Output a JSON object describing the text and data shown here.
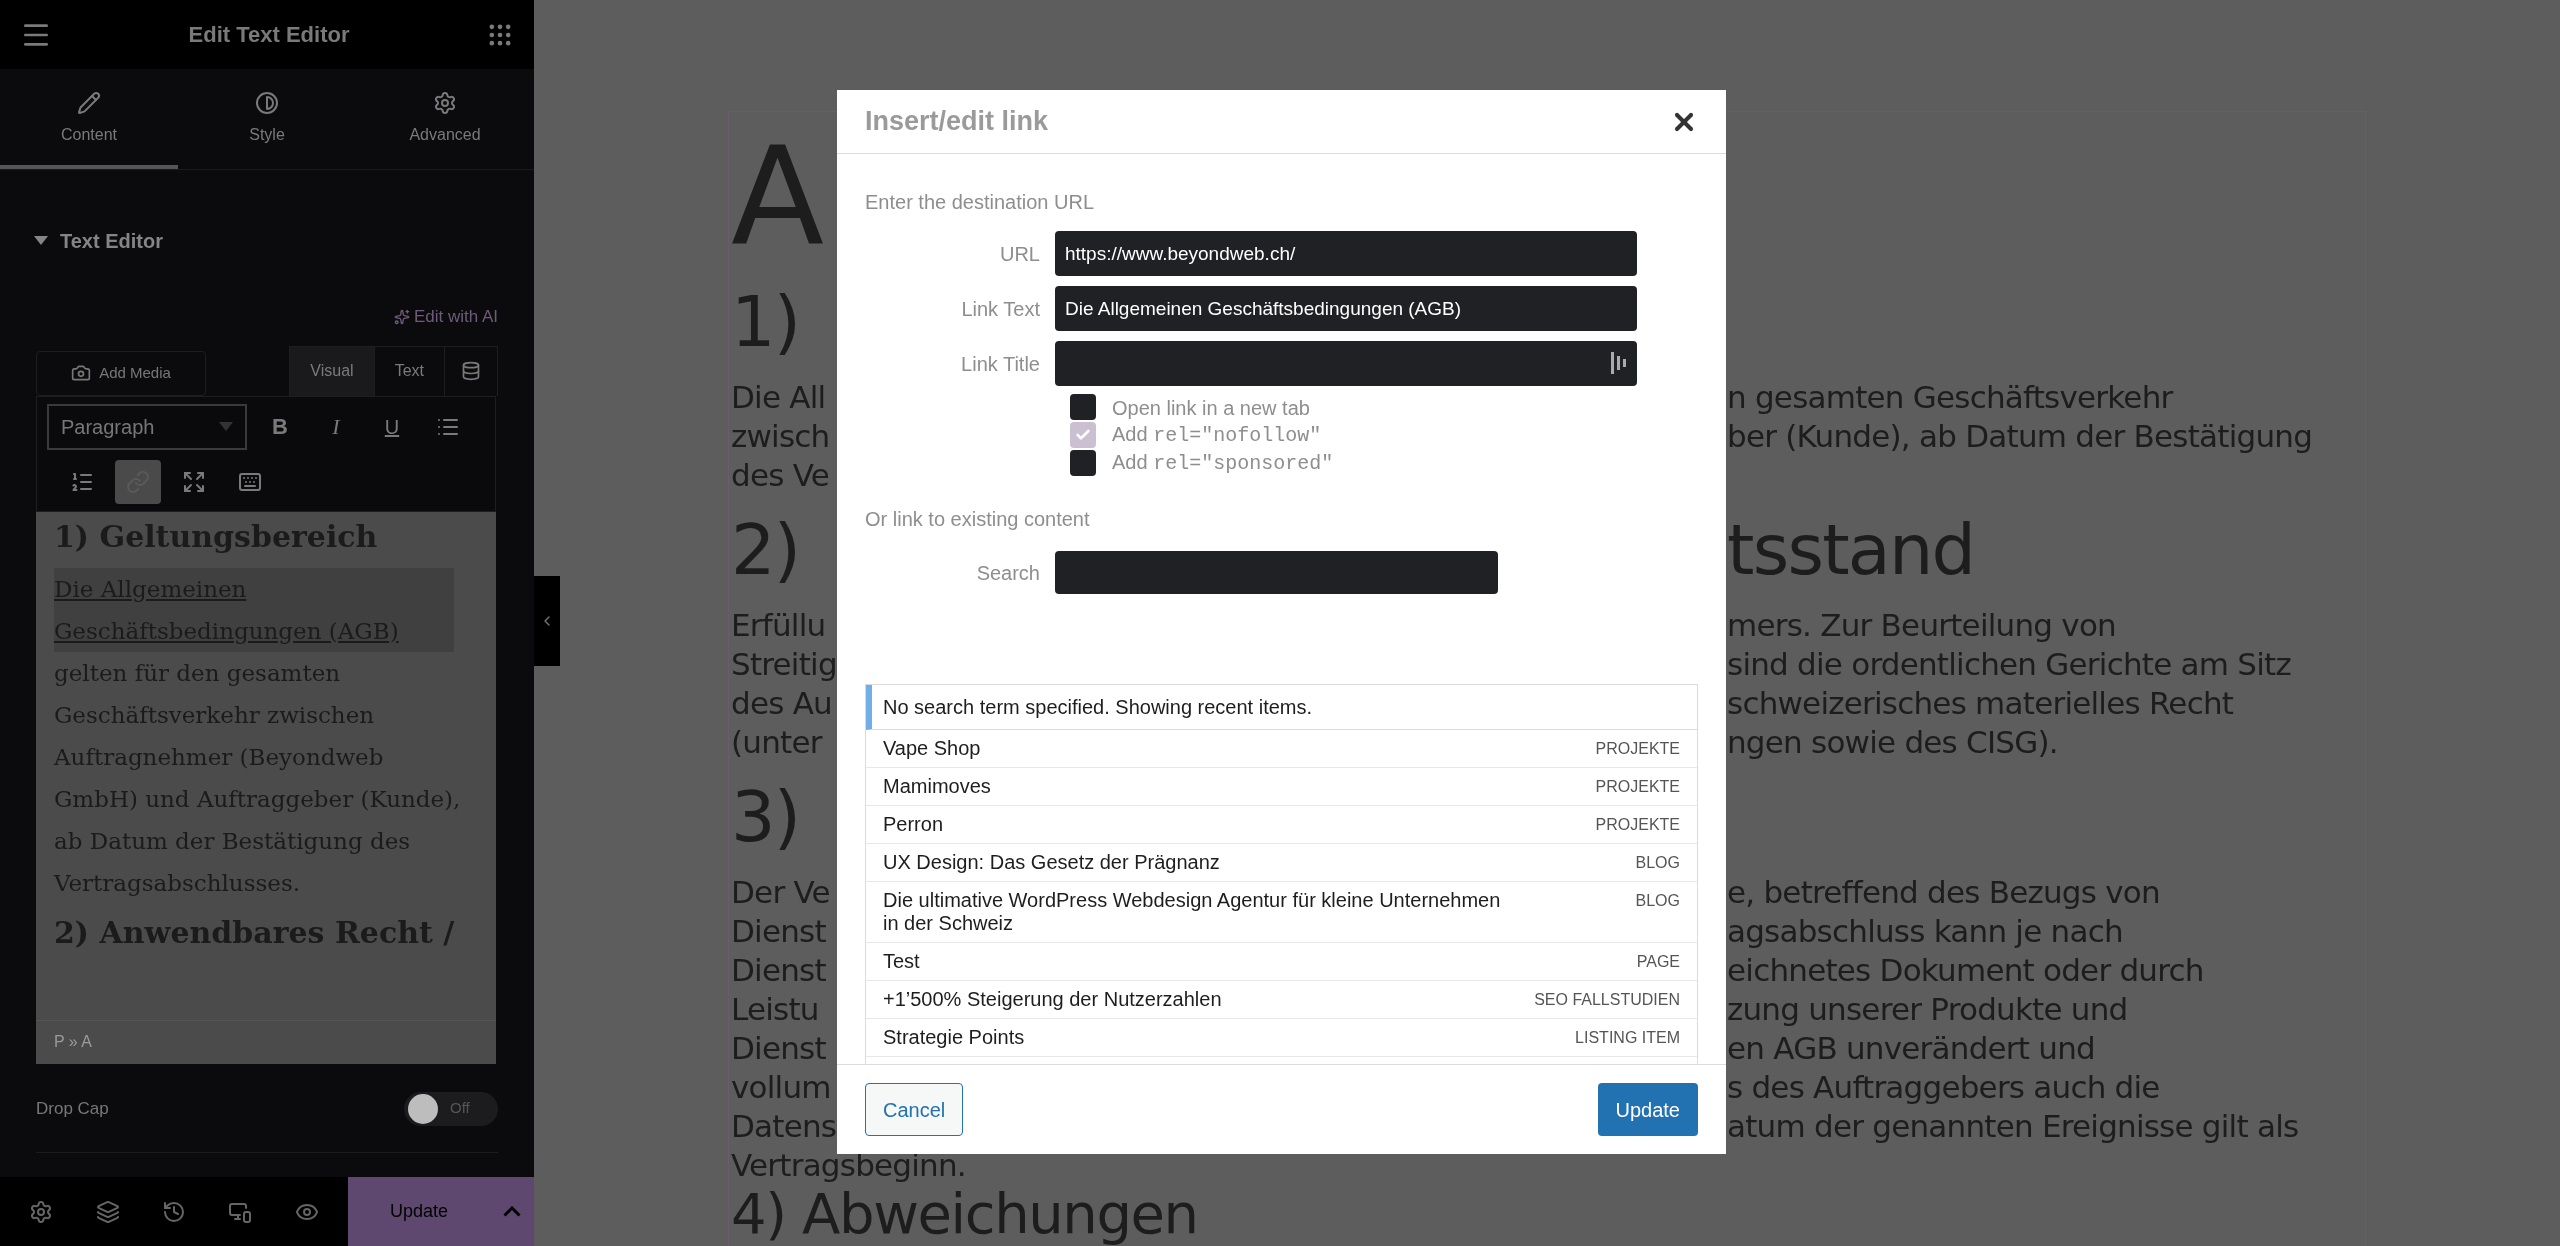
{
  "sidebar": {
    "title": "Edit Text Editor",
    "tabs": [
      {
        "label": "Content",
        "selected": true,
        "kind": "pencil"
      },
      {
        "label": "Style",
        "selected": false,
        "kind": "contrast"
      },
      {
        "label": "Advanced",
        "selected": false,
        "kind": "gear"
      }
    ],
    "section": {
      "title": "Text Editor",
      "expanded": true
    },
    "ai_link": "Edit with AI",
    "add_media": "Add Media",
    "editor_modes": [
      {
        "label": "Visual",
        "selected": true
      },
      {
        "label": "Text",
        "selected": false
      }
    ],
    "format_select": "Paragraph",
    "toolbar": [
      {
        "kind": "bold",
        "label": "B",
        "active": false
      },
      {
        "kind": "italic",
        "label": "I",
        "active": false
      },
      {
        "kind": "underline",
        "label": "U",
        "active": false
      },
      {
        "kind": "bullets",
        "active": false
      },
      {
        "kind": "numbers",
        "active": false
      },
      {
        "kind": "link",
        "active": true
      },
      {
        "kind": "fullscreen",
        "active": false
      },
      {
        "kind": "toolbar-toggle",
        "active": false
      }
    ],
    "editor": {
      "heading_1": "1) Geltungsbereich",
      "link": "Die Allgemeinen Geschäftsbedingungen (AGB)",
      "paragraph": "gelten für den gesamten Geschäftsverkehr zwischen Auftragnehmer (Beyondweb GmbH) und Auftraggeber (Kunde), ab Datum der Bestätigung des Vertragsabschlusses.",
      "heading_2": "2) Anwendbares Recht /",
      "path": "P » A"
    },
    "drop_cap": {
      "label": "Drop Cap",
      "on": false,
      "state_text": "Off"
    },
    "update_button": "Update"
  },
  "page": {
    "title": "A",
    "lines": [
      {
        "kind": "heading",
        "left": "1)"
      },
      {
        "kind": "text",
        "left": "Die All",
        "right": "n gesamten Geschäftsverkehr"
      },
      {
        "kind": "text",
        "left": "zwisch",
        "right": "ber (Kunde), ab Datum der Bestätigung"
      },
      {
        "kind": "text",
        "left": "des Ve"
      },
      {
        "kind": "heading",
        "left": "2)",
        "right": "tsstand"
      },
      {
        "kind": "text",
        "left": "Erfüllu",
        "right": "mers. Zur Beurteilung von"
      },
      {
        "kind": "text",
        "left": "Streitig",
        "right": "sind die ordentlichen Gerichte am Sitz"
      },
      {
        "kind": "text",
        "left": "des Au",
        "right": "schweizerisches materielles Recht"
      },
      {
        "kind": "text",
        "left": "(unter",
        "right": "ngen sowie des CISG)."
      },
      {
        "kind": "heading",
        "left": "3)"
      },
      {
        "kind": "text",
        "left": "Der Ve",
        "right": "e, betreffend des Bezugs von"
      },
      {
        "kind": "text",
        "left": "Dienst",
        "right": "agsabschluss kann je nach"
      },
      {
        "kind": "text",
        "left": "Dienst",
        "right": "eichnetes Dokument oder durch"
      },
      {
        "kind": "text",
        "left": "Leistu",
        "right": "zung unserer Produkte und"
      },
      {
        "kind": "text",
        "left": "Dienst",
        "right": "en AGB unverändert und"
      },
      {
        "kind": "text",
        "left": "vollum",
        "right": "s des Auftraggebers auch die"
      },
      {
        "kind": "text",
        "left": "Datens",
        "right": "atum der genannten Ereignisse gilt als"
      },
      {
        "kind": "text",
        "left": "Vertragsbeginn."
      },
      {
        "kind": "heading",
        "left": "4) Abweichungen"
      }
    ]
  },
  "dialog": {
    "title": "Insert/edit link",
    "url_section": "Enter the destination URL",
    "fields": [
      {
        "label": "URL",
        "value": "https://www.beyondweb.ch/"
      },
      {
        "label": "Link Text",
        "value": "Die Allgemeinen Geschäftsbedingungen (AGB)"
      },
      {
        "label": "Link Title"
      }
    ],
    "options": [
      {
        "label": "Open link in a new tab",
        "checked": false
      },
      {
        "label": "Add",
        "code": "rel=\"nofollow\"",
        "checked": true
      },
      {
        "label": "Add",
        "code": "rel=\"sponsored\"",
        "checked": false
      }
    ],
    "existing_section": "Or link to existing content",
    "search_label": "Search",
    "notice": "No search term specified. Showing recent items.",
    "results": [
      {
        "title": "Vape Shop",
        "type": "PROJEKTE"
      },
      {
        "title": "Mamimoves",
        "type": "PROJEKTE"
      },
      {
        "title": "Perron",
        "type": "PROJEKTE"
      },
      {
        "title": "UX Design: Das Gesetz der Prägnanz",
        "type": "BLOG"
      },
      {
        "title": "Die ultimative WordPress Webdesign Agentur für kleine Unternehmen in der Schweiz",
        "type": "BLOG"
      },
      {
        "title": "Test",
        "type": "PAGE"
      },
      {
        "title": "+1’500% Steigerung der Nutzerzahlen",
        "type": "SEO FALLSTUDIEN"
      },
      {
        "title": "Strategie Points",
        "type": "LISTING ITEM"
      }
    ],
    "cancel": "Cancel",
    "update": "Update"
  }
}
